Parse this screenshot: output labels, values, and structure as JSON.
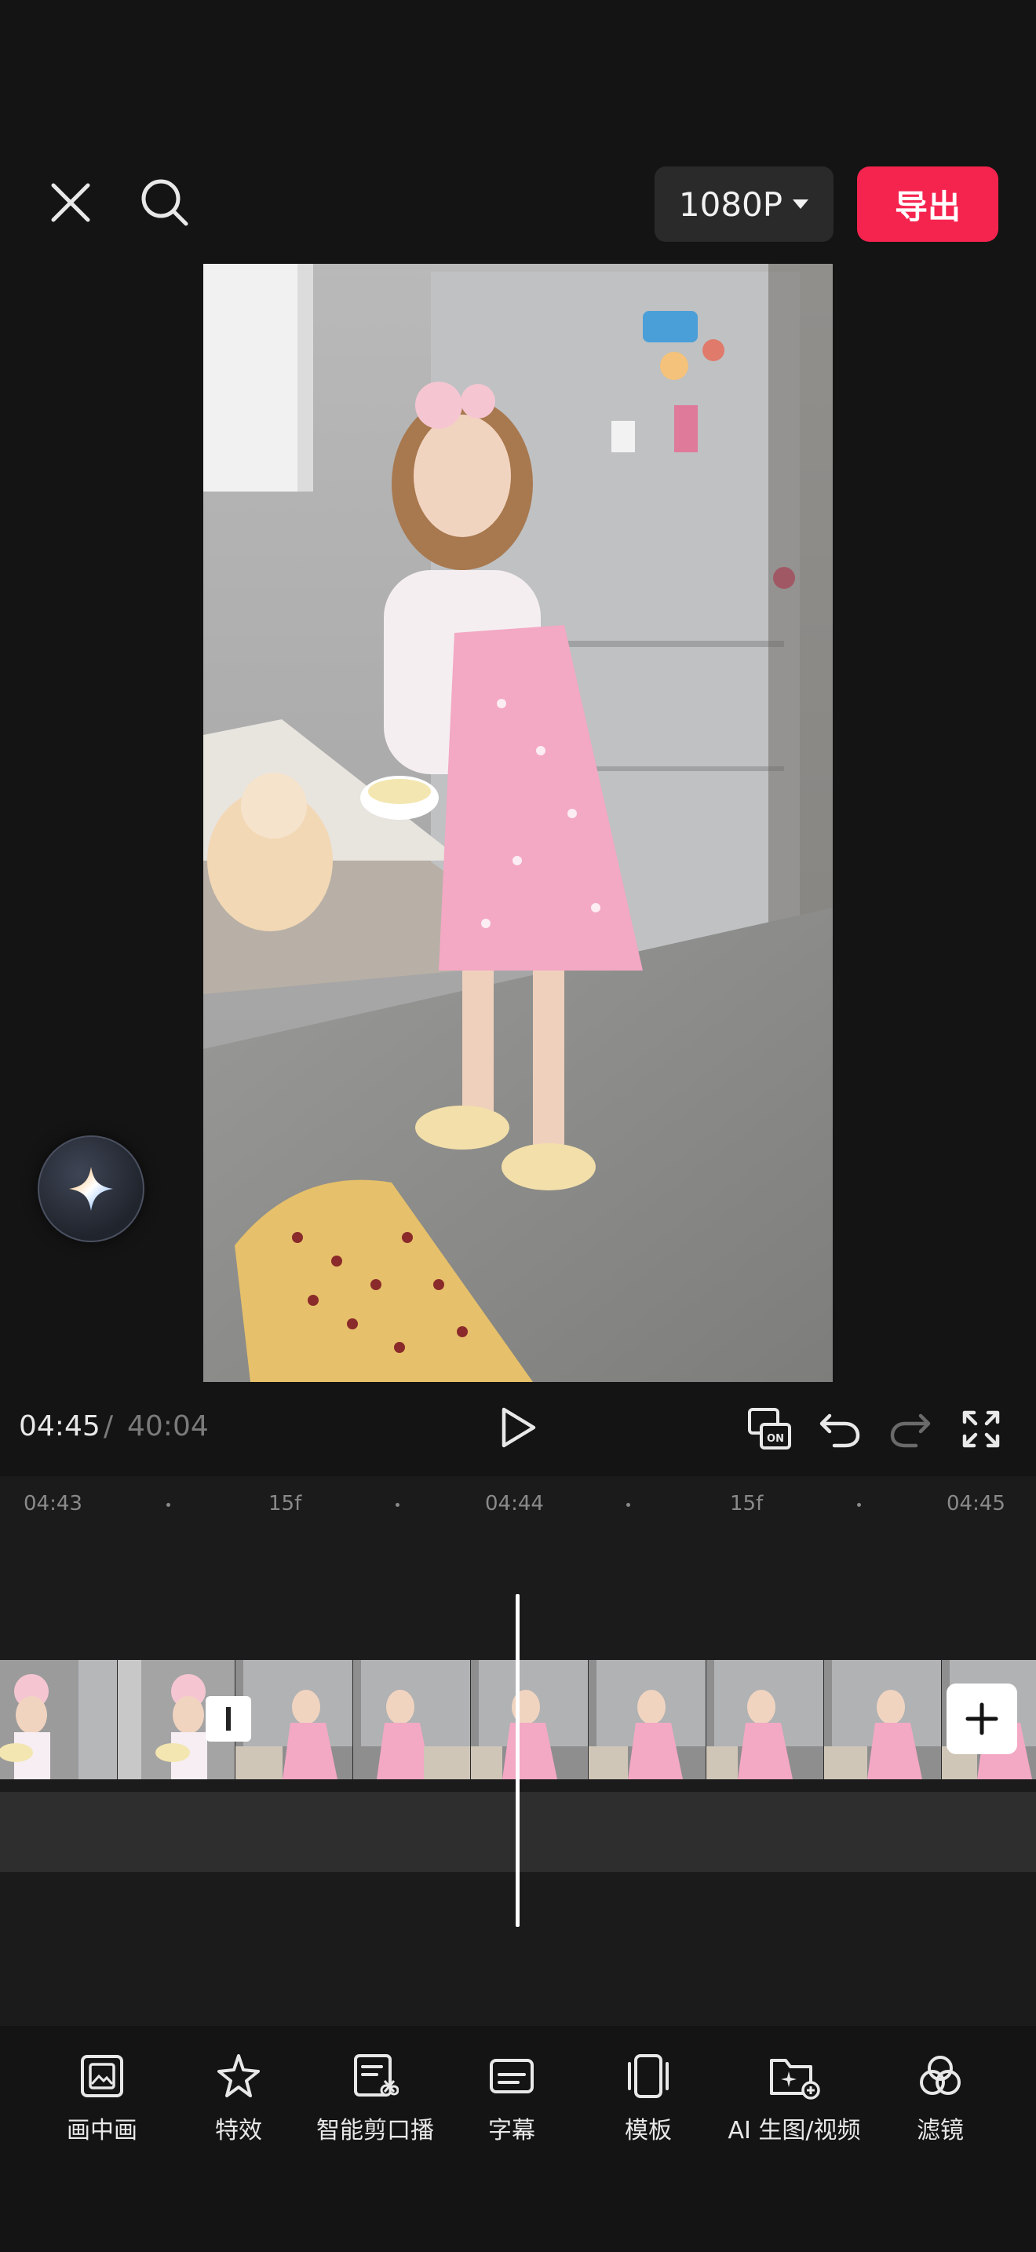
{
  "topbar": {
    "resolution_label": "1080P",
    "export_label": "导出"
  },
  "playback": {
    "current_time": "04:45",
    "separator": "/",
    "total_time": "40:04"
  },
  "ruler": {
    "labels": [
      "04:43",
      "15f",
      "04:44",
      "15f",
      "04:45"
    ]
  },
  "toolbar": {
    "items": [
      {
        "label": "画中画",
        "icon": "picture-in-picture-icon"
      },
      {
        "label": "特效",
        "icon": "effects-star-icon"
      },
      {
        "label": "智能剪口播",
        "icon": "smart-cut-icon"
      },
      {
        "label": "字幕",
        "icon": "subtitle-icon"
      },
      {
        "label": "模板",
        "icon": "template-icon"
      },
      {
        "label": "AI 生图/视频",
        "icon": "ai-generate-icon"
      },
      {
        "label": "滤镜",
        "icon": "filter-icon"
      }
    ]
  },
  "colors": {
    "accent": "#f5244f",
    "background": "#141414",
    "timeline": "#1b1b1b"
  }
}
